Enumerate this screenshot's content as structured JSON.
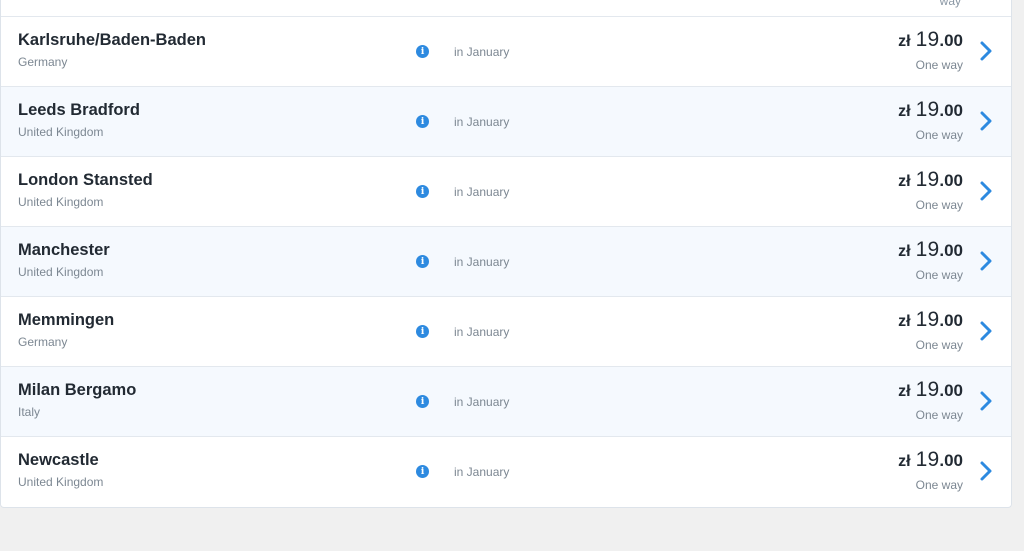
{
  "accent_color": "#2d8ae0",
  "top_stub": {
    "text": "way"
  },
  "destinations": [
    {
      "city": "Karlsruhe/Baden-Baden",
      "country": "Germany",
      "when": "in January",
      "currency": "zł",
      "price_int": "19",
      "price_dec": ".00",
      "fare_type": "One way"
    },
    {
      "city": "Leeds Bradford",
      "country": "United Kingdom",
      "when": "in January",
      "currency": "zł",
      "price_int": "19",
      "price_dec": ".00",
      "fare_type": "One way"
    },
    {
      "city": "London Stansted",
      "country": "United Kingdom",
      "when": "in January",
      "currency": "zł",
      "price_int": "19",
      "price_dec": ".00",
      "fare_type": "One way"
    },
    {
      "city": "Manchester",
      "country": "United Kingdom",
      "when": "in January",
      "currency": "zł",
      "price_int": "19",
      "price_dec": ".00",
      "fare_type": "One way"
    },
    {
      "city": "Memmingen",
      "country": "Germany",
      "when": "in January",
      "currency": "zł",
      "price_int": "19",
      "price_dec": ".00",
      "fare_type": "One way"
    },
    {
      "city": "Milan Bergamo",
      "country": "Italy",
      "when": "in January",
      "currency": "zł",
      "price_int": "19",
      "price_dec": ".00",
      "fare_type": "One way"
    },
    {
      "city": "Newcastle",
      "country": "United Kingdom",
      "when": "in January",
      "currency": "zł",
      "price_int": "19",
      "price_dec": ".00",
      "fare_type": "One way"
    }
  ]
}
